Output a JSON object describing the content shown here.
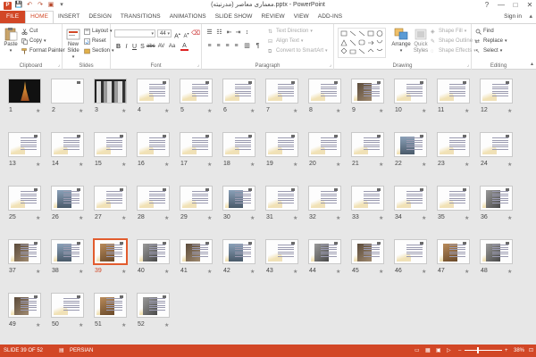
{
  "window": {
    "title": "معماری معاصر (مدرنیته).pptx - PowerPoint",
    "sign_in": "Sign in",
    "help": "?",
    "minimize": "—",
    "maximize": "□",
    "close": "✕"
  },
  "qat": {
    "save": "💾",
    "undo": "↶",
    "redo": "↷",
    "start": "▣",
    "customize": "▾"
  },
  "tabs": [
    {
      "label": "FILE"
    },
    {
      "label": "HOME"
    },
    {
      "label": "INSERT"
    },
    {
      "label": "DESIGN"
    },
    {
      "label": "TRANSITIONS"
    },
    {
      "label": "ANIMATIONS"
    },
    {
      "label": "SLIDE SHOW"
    },
    {
      "label": "REVIEW"
    },
    {
      "label": "VIEW"
    },
    {
      "label": "ADD-INS"
    }
  ],
  "ribbon": {
    "clipboard": {
      "label": "Clipboard",
      "paste": "Paste",
      "cut": "Cut",
      "copy": "Copy",
      "format_painter": "Format Painter"
    },
    "slides": {
      "label": "Slides",
      "new_slide": "New Slide",
      "layout": "Layout",
      "reset": "Reset",
      "section": "Section"
    },
    "font": {
      "label": "Font",
      "size": "44"
    },
    "paragraph": {
      "label": "Paragraph",
      "text_direction": "Text Direction",
      "align_text": "Align Text",
      "convert": "Convert to SmartArt"
    },
    "drawing": {
      "label": "Drawing",
      "arrange": "Arrange",
      "quick_styles": "Quick Styles",
      "shape_fill": "Shape Fill",
      "shape_outline": "Shape Outline",
      "shape_effects": "Shape Effects"
    },
    "editing": {
      "label": "Editing",
      "find": "Find",
      "replace": "Replace",
      "select": "Select"
    }
  },
  "slides": [
    {
      "n": "1",
      "type": "dark"
    },
    {
      "n": "2",
      "type": "white"
    },
    {
      "n": "3",
      "type": "bw"
    },
    {
      "n": "4",
      "type": "text"
    },
    {
      "n": "5",
      "type": "text"
    },
    {
      "n": "6",
      "type": "text"
    },
    {
      "n": "7",
      "type": "text"
    },
    {
      "n": "8",
      "type": "text"
    },
    {
      "n": "9",
      "type": "pic"
    },
    {
      "n": "10",
      "type": "text"
    },
    {
      "n": "11",
      "type": "text"
    },
    {
      "n": "12",
      "type": "text"
    },
    {
      "n": "13",
      "type": "text"
    },
    {
      "n": "14",
      "type": "text"
    },
    {
      "n": "15",
      "type": "text"
    },
    {
      "n": "16",
      "type": "text"
    },
    {
      "n": "17",
      "type": "text"
    },
    {
      "n": "18",
      "type": "text"
    },
    {
      "n": "19",
      "type": "text"
    },
    {
      "n": "20",
      "type": "text"
    },
    {
      "n": "21",
      "type": "text"
    },
    {
      "n": "22",
      "type": "pic"
    },
    {
      "n": "23",
      "type": "text"
    },
    {
      "n": "24",
      "type": "text"
    },
    {
      "n": "25",
      "type": "text"
    },
    {
      "n": "26",
      "type": "pic"
    },
    {
      "n": "27",
      "type": "text"
    },
    {
      "n": "28",
      "type": "text"
    },
    {
      "n": "29",
      "type": "text"
    },
    {
      "n": "30",
      "type": "pic"
    },
    {
      "n": "31",
      "type": "text"
    },
    {
      "n": "32",
      "type": "text"
    },
    {
      "n": "33",
      "type": "text"
    },
    {
      "n": "34",
      "type": "text"
    },
    {
      "n": "35",
      "type": "text"
    },
    {
      "n": "36",
      "type": "pic"
    },
    {
      "n": "37",
      "type": "pic"
    },
    {
      "n": "38",
      "type": "pic"
    },
    {
      "n": "39",
      "type": "pic",
      "selected": true
    },
    {
      "n": "40",
      "type": "pic"
    },
    {
      "n": "41",
      "type": "pic"
    },
    {
      "n": "42",
      "type": "pic"
    },
    {
      "n": "43",
      "type": "text"
    },
    {
      "n": "44",
      "type": "pic"
    },
    {
      "n": "45",
      "type": "pic"
    },
    {
      "n": "46",
      "type": "text"
    },
    {
      "n": "47",
      "type": "pic"
    },
    {
      "n": "48",
      "type": "pic"
    },
    {
      "n": "49",
      "type": "pic"
    },
    {
      "n": "50",
      "type": "text"
    },
    {
      "n": "51",
      "type": "pic"
    },
    {
      "n": "52",
      "type": "pic"
    }
  ],
  "status": {
    "slide_info": "SLIDE 39 OF 52",
    "language": "PERSIAN",
    "zoom": "38%",
    "zoom_minus": "–",
    "zoom_plus": "+"
  },
  "colors": {
    "accent": "#d24726",
    "sorter_bg": "#e7e7e7"
  }
}
